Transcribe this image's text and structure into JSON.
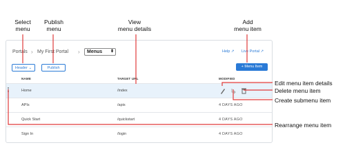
{
  "annotations": {
    "select_menu": "Select\nmenu",
    "publish_menu": "Publish\nmenu",
    "view_menu_details": "View\nmenu details",
    "add_menu_item": "Add\nmenu item",
    "edit_menu_item_details": "Edit menu item details",
    "delete_menu_item": "Delete menu item",
    "create_submenu_item": "Create submenu item",
    "rearrange_menu_item": "Rearrange menu item"
  },
  "header": {
    "breadcrumb_portals": "Portals",
    "breadcrumb_portal": "My First Portal",
    "menu_select_value": "Menus",
    "help_link": "Help",
    "live_portal_link": "Live Portal"
  },
  "toolbar": {
    "header_dropdown": "Header",
    "publish_button": "Publish",
    "add_menu_item_button": "+ Menu Item"
  },
  "table": {
    "columns": [
      "NAME",
      "TARGET URL",
      "MODIFIED"
    ],
    "rows": [
      {
        "name": "Home",
        "target": "/index",
        "modified": ""
      },
      {
        "name": "APIs",
        "target": "/apis",
        "modified": "4 DAYS AGO"
      },
      {
        "name": "Quick Start",
        "target": "/quickstart",
        "modified": "4 DAYS AGO"
      },
      {
        "name": "Sign In",
        "target": "/login",
        "modified": "4 DAYS AGO"
      }
    ]
  },
  "colors": {
    "accent": "#2a7ad6",
    "annotation_line": "#e03a3a",
    "selected_row": "#e8f2fb"
  },
  "icons": [
    "external-link-icon",
    "caret-down-icon",
    "pencil-icon",
    "submenu-icon",
    "trash-icon",
    "drag-handle-icon"
  ]
}
